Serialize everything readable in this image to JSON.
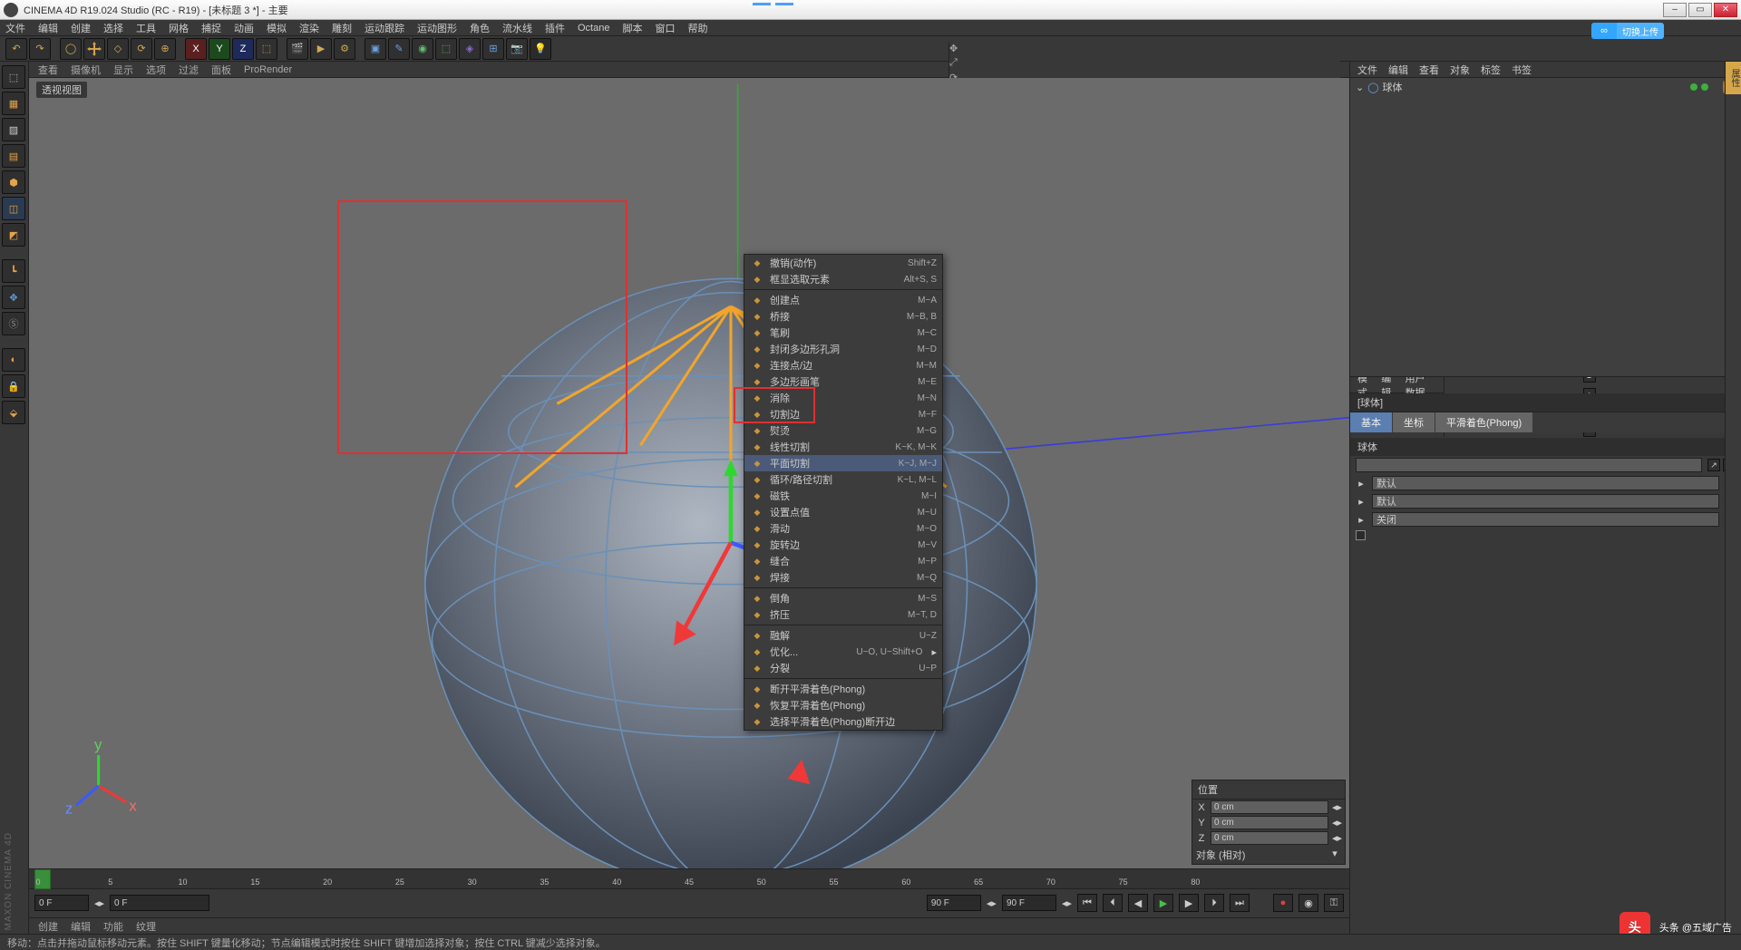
{
  "title": "CINEMA 4D R19.024 Studio (RC - R19) - [未标题 3 *] - 主要",
  "bluebadge": "切换上传",
  "menu": [
    "文件",
    "编辑",
    "创建",
    "选择",
    "工具",
    "网格",
    "捕捉",
    "动画",
    "模拟",
    "渲染",
    "雕刻",
    "运动跟踪",
    "运动图形",
    "角色",
    "流水线",
    "插件",
    "Octane",
    "脚本",
    "窗口",
    "帮助"
  ],
  "axis_labels": {
    "x": "X",
    "y": "Y",
    "z": "Z"
  },
  "view_menu": [
    "查看",
    "摄像机",
    "显示",
    "选项",
    "过滤",
    "面板",
    "ProRender"
  ],
  "viewport_label": "透视视图",
  "timeline": {
    "start": "0 F",
    "range": "0 F",
    "end": "90 F",
    "end2": "90 F",
    "ticks": [
      0,
      5,
      10,
      15,
      20,
      25,
      30,
      35,
      40,
      45,
      50,
      55,
      60,
      65,
      70,
      75,
      80
    ]
  },
  "bottom_tabs": [
    "创建",
    "编辑",
    "功能",
    "纹理"
  ],
  "om_menu": [
    "文件",
    "编辑",
    "查看",
    "对象",
    "标签",
    "书签"
  ],
  "tree": {
    "obj": "球体"
  },
  "attr_menu": [
    "模式",
    "编辑",
    "用户数据"
  ],
  "attr": {
    "title": "[球体]",
    "tab_basic": "基本",
    "tab_coord": "坐标",
    "tab_phong": "平滑着色(Phong)",
    "group": "球体",
    "f1": "默认",
    "f2": "默认",
    "f3": "关闭"
  },
  "coord": {
    "head1": "位置",
    "x": "0 cm",
    "y": "0 cm",
    "z": "0 cm",
    "mode": "对象 (相对)"
  },
  "ctx": [
    {
      "label": "撤销(动作)",
      "sc": "Shift+Z"
    },
    {
      "label": "框显选取元素",
      "sc": "Alt+S, S"
    },
    {
      "sep": true
    },
    {
      "label": "创建点",
      "sc": "M~A"
    },
    {
      "label": "桥接",
      "sc": "M~B, B"
    },
    {
      "label": "笔刷",
      "sc": "M~C"
    },
    {
      "label": "封闭多边形孔洞",
      "sc": "M~D"
    },
    {
      "label": "连接点/边",
      "sc": "M~M"
    },
    {
      "label": "多边形画笔",
      "sc": "M~E"
    },
    {
      "label": "消除",
      "sc": "M~N",
      "hl": false
    },
    {
      "label": "切割边",
      "sc": "M~F"
    },
    {
      "label": "熨烫",
      "sc": "M~G"
    },
    {
      "label": "线性切割",
      "sc": "K~K, M~K"
    },
    {
      "label": "平面切割",
      "sc": "K~J, M~J",
      "hl": true
    },
    {
      "label": "循环/路径切割",
      "sc": "K~L, M~L"
    },
    {
      "label": "磁铁",
      "sc": "M~I"
    },
    {
      "label": "设置点值",
      "sc": "M~U"
    },
    {
      "label": "滑动",
      "sc": "M~O"
    },
    {
      "label": "旋转边",
      "sc": "M~V"
    },
    {
      "label": "缝合",
      "sc": "M~P"
    },
    {
      "label": "焊接",
      "sc": "M~Q"
    },
    {
      "sep": true
    },
    {
      "label": "倒角",
      "sc": "M~S"
    },
    {
      "label": "挤压",
      "sc": "M~T, D"
    },
    {
      "sep": true
    },
    {
      "label": "融解",
      "sc": "U~Z"
    },
    {
      "label": "优化...",
      "sc": "U~O, U~Shift+O",
      "more": true
    },
    {
      "label": "分裂",
      "sc": "U~P"
    },
    {
      "sep": true
    },
    {
      "label": "断开平滑着色(Phong)",
      "sc": ""
    },
    {
      "label": "恢复平滑着色(Phong)",
      "sc": ""
    },
    {
      "label": "选择平滑着色(Phong)断开边",
      "sc": ""
    }
  ],
  "status": "移动：点击并拖动鼠标移动元素。按住 SHIFT 键量化移动；节点编辑模式时按住 SHIFT 键增加选择对象；按住 CTRL 键减少选择对象。",
  "watermark": "头条 @五域广告",
  "vlogo": "MAXON CINEMA 4D"
}
